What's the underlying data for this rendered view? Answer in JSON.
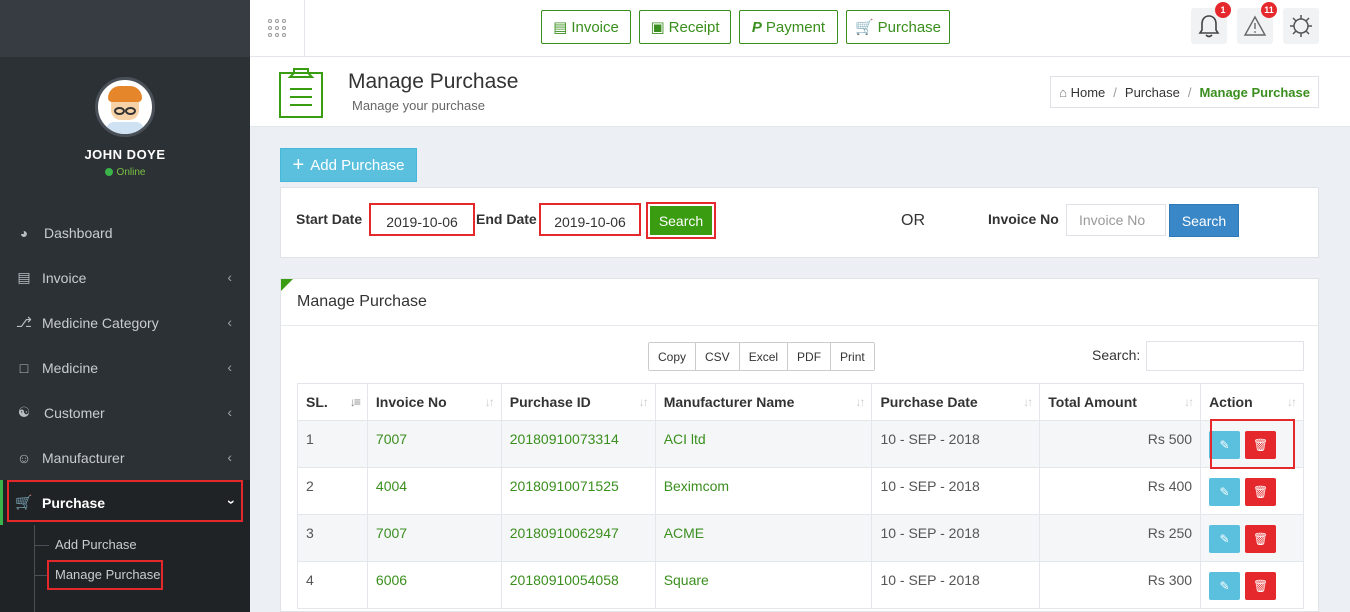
{
  "sidebar": {
    "user": {
      "name": "JOHN DOYE",
      "status": "Online"
    },
    "items": [
      {
        "label": "Dashboard",
        "icon": "dashboard-icon"
      },
      {
        "label": "Invoice",
        "icon": "invoice-icon"
      },
      {
        "label": "Medicine Category",
        "icon": "category-icon"
      },
      {
        "label": "Medicine",
        "icon": "medicine-icon"
      },
      {
        "label": "Customer",
        "icon": "customer-icon"
      },
      {
        "label": "Manufacturer",
        "icon": "manufacturer-icon"
      },
      {
        "label": "Purchase",
        "icon": "cart-icon"
      }
    ],
    "submenu": [
      {
        "label": "Add Purchase"
      },
      {
        "label": "Manage Purchase"
      }
    ]
  },
  "header": {
    "buttons": [
      {
        "label": "Invoice",
        "icon": "invoice-icon"
      },
      {
        "label": "Receipt",
        "icon": "money-icon"
      },
      {
        "label": "Payment",
        "icon": "paypal-icon"
      },
      {
        "label": "Purchase",
        "icon": "cart-icon"
      }
    ],
    "notifications_count": "1",
    "alerts_count": "11"
  },
  "page": {
    "title": "Manage Purchase",
    "subtitle": "Manage your purchase",
    "breadcrumb": [
      "Home",
      "Purchase",
      "Manage Purchase"
    ]
  },
  "actions": {
    "add_label": "Add Purchase"
  },
  "filter": {
    "start_label": "Start Date",
    "start_value": "2019-10-06",
    "end_label": "End Date",
    "end_value": "2019-10-06",
    "search_label": "Search",
    "or_label": "OR",
    "invoice_label": "Invoice No",
    "invoice_placeholder": "Invoice No",
    "invoice_search_label": "Search"
  },
  "table_panel": {
    "title": "Manage Purchase",
    "export_buttons": [
      "Copy",
      "CSV",
      "Excel",
      "PDF",
      "Print"
    ],
    "search_label": "Search:",
    "columns": [
      "SL.",
      "Invoice No",
      "Purchase ID",
      "Manufacturer Name",
      "Purchase Date",
      "Total Amount",
      "Action"
    ],
    "rows": [
      {
        "sl": "1",
        "invoice": "7007",
        "purchase_id": "20180910073314",
        "manufacturer": "ACI ltd",
        "date": "10 - SEP - 2018",
        "amount": "Rs 500"
      },
      {
        "sl": "2",
        "invoice": "4004",
        "purchase_id": "20180910071525",
        "manufacturer": "Beximcom",
        "date": "10 - SEP - 2018",
        "amount": "Rs 400"
      },
      {
        "sl": "3",
        "invoice": "7007",
        "purchase_id": "20180910062947",
        "manufacturer": "ACME",
        "date": "10 - SEP - 2018",
        "amount": "Rs 250"
      },
      {
        "sl": "4",
        "invoice": "6006",
        "purchase_id": "20180910054058",
        "manufacturer": "Square",
        "date": "10 - SEP - 2018",
        "amount": "Rs 300"
      }
    ]
  },
  "colors": {
    "accent": "#3a8f1e",
    "highlight": "#e4282b",
    "info": "#5bc0de",
    "primary": "#3a87c8"
  }
}
